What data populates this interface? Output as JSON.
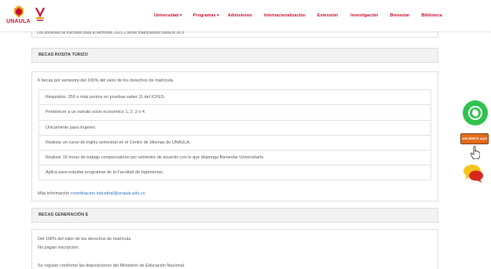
{
  "header": {
    "logo_text": "UNAULA",
    "nav": [
      {
        "label": "Universidad ▾"
      },
      {
        "label": "Programas ▾"
      },
      {
        "label": "Admisiones"
      },
      {
        "label": "Internacionalización"
      },
      {
        "label": "Extensión"
      },
      {
        "label": "Investigación"
      },
      {
        "label": "Bienestar"
      },
      {
        "label": "Biblioteca"
      }
    ]
  },
  "top_partial_text": "Los docentes se inscriben para el semestre 2023-1 serán matriculados hasta el 30 d",
  "becas_rosita": {
    "title": "BECAS ROSITA TURIZO",
    "intro": "6 becas por semestre del 100% del valor de los derechos de matrícula.",
    "requirements": [
      "Requisitos: 250 o más puntos en pruebas saber 11 del ICFES.",
      "Pertenecer a un estrato socio económico 1, 2, 3 o 4.",
      "Únicamente para mujeres.",
      "Realizar un curso de inglés semestral en el Centro de Idiomas de UNAULA.",
      "Realizar 16 horas de trabajo compensatorio por semestre de acuerdo con lo que disponga Bienestar Universitario.",
      "Aplica para estudiar programas de la Facultad de Ingenierías."
    ],
    "more_info_label": "Más información",
    "more_info_email": "coordinacion.industrial@unaula.edu.co"
  },
  "becas_generacion": {
    "title": "BECAS GENERACIÓN E",
    "lines": [
      "Del 100% del valor de los derechos de matrícula",
      "No pagan inscripción.",
      "Se regulan conforme las disposiciones del Ministerio de Educación Nacional."
    ]
  },
  "widgets": {
    "inscribete_label": "INSCRÍBETE AQUÍ",
    "whatsapp_color": "#2fc24e",
    "inscribete_color": "#e36b1c",
    "chat_colors": [
      "#f5c518",
      "#d6281c"
    ]
  },
  "colors": {
    "brand_red": "#c8102e",
    "link_blue": "#2b72c2"
  }
}
